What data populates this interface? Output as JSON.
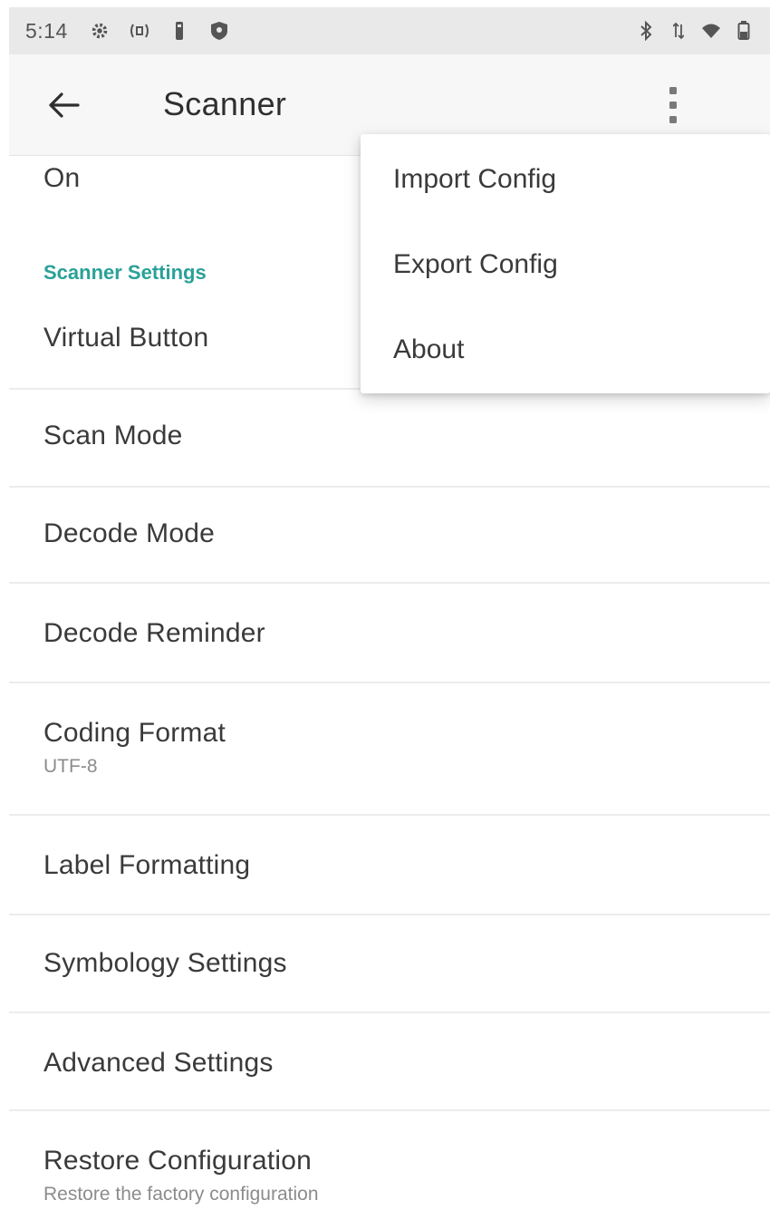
{
  "status_bar": {
    "time": "5:14",
    "left_icons": [
      "settings-gear-icon",
      "signal-cast-icon",
      "usb-icon",
      "shield-icon"
    ],
    "right_icons": [
      "bluetooth-icon",
      "data-arrows-icon",
      "wifi-icon",
      "battery-icon"
    ]
  },
  "app_bar": {
    "title": "Scanner"
  },
  "list": {
    "top_value": "On",
    "section_header": "Scanner Settings",
    "items": [
      {
        "title": "Virtual Button",
        "subtitle": ""
      },
      {
        "title": "Scan Mode",
        "subtitle": ""
      },
      {
        "title": "Decode Mode",
        "subtitle": ""
      },
      {
        "title": "Decode Reminder",
        "subtitle": ""
      },
      {
        "title": "Coding Format",
        "subtitle": "UTF-8"
      },
      {
        "title": "Label Formatting",
        "subtitle": ""
      },
      {
        "title": "Symbology Settings",
        "subtitle": ""
      },
      {
        "title": "Advanced Settings",
        "subtitle": ""
      },
      {
        "title": "Restore Configuration",
        "subtitle": "Restore the factory configuration"
      }
    ]
  },
  "popup_menu": {
    "items": [
      {
        "label": "Import Config"
      },
      {
        "label": "Export Config"
      },
      {
        "label": "About"
      }
    ]
  },
  "colors": {
    "accent": "#2aa198",
    "status_bar_bg": "#e9e9e9",
    "app_bar_bg": "#f7f7f7"
  }
}
